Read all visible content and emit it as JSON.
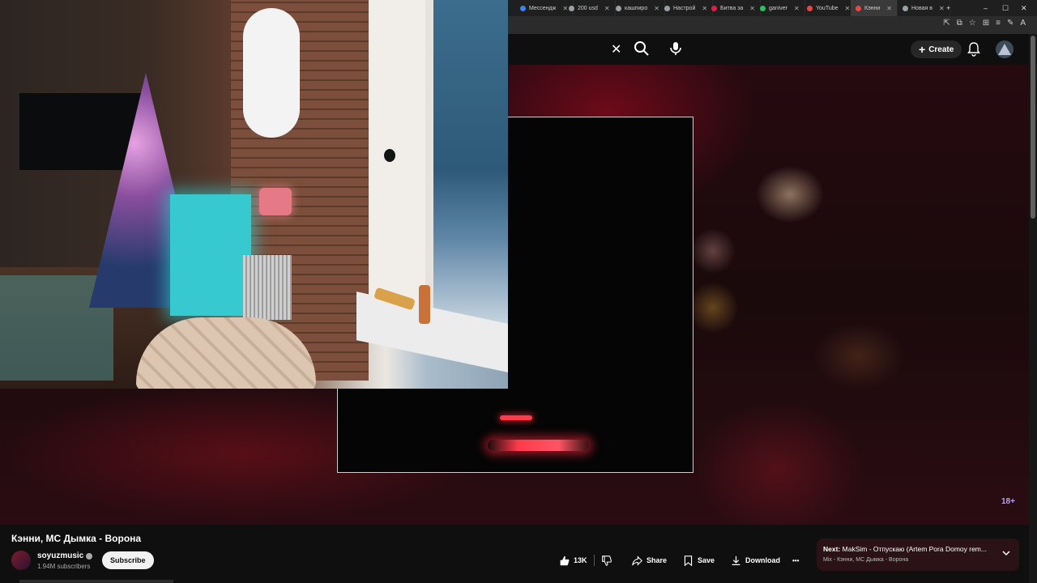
{
  "browser": {
    "tabs": [
      {
        "label": "Мессендж",
        "color": "#3b82f6"
      },
      {
        "label": "200 usd",
        "color": "#9aa0a6"
      },
      {
        "label": "кашпиро",
        "color": "#9aa0a6"
      },
      {
        "label": "Настрой",
        "color": "#9aa0a6"
      },
      {
        "label": "Битва за",
        "color": "#e11d48"
      },
      {
        "label": "ganiver",
        "color": "#22c55e"
      },
      {
        "label": "YouTube",
        "color": "#ef4444"
      },
      {
        "label": "Кэнни",
        "color": "#ef4444",
        "active": true
      },
      {
        "label": "Новая в",
        "color": "#9aa0a6"
      }
    ],
    "new_tab": "+",
    "win_min": "–",
    "win_max": "☐",
    "win_close": "✕",
    "addr_icons": [
      "⇱",
      "⧉",
      "☆",
      "⊞",
      "≡",
      "✎",
      "A"
    ]
  },
  "masthead": {
    "search_clear": "✕",
    "create_label": "Create",
    "create_plus": "+"
  },
  "player": {
    "age_badge": "18+"
  },
  "info": {
    "title": "Кэнни, МС Дымка - Ворона",
    "channel_name": "soyuzmusic",
    "subscribers": "1.94M subscribers",
    "subscribe_label": "Subscribe",
    "like_count": "13K",
    "share_label": "Share",
    "save_label": "Save",
    "download_label": "Download",
    "more_label": "•••",
    "next_prefix": "Next:",
    "next_title": "MakSim - Отпускаю (Artem Pora Domoy rem...",
    "next_sub": "Mix - Кэнни, МС Дымка - Ворона"
  }
}
